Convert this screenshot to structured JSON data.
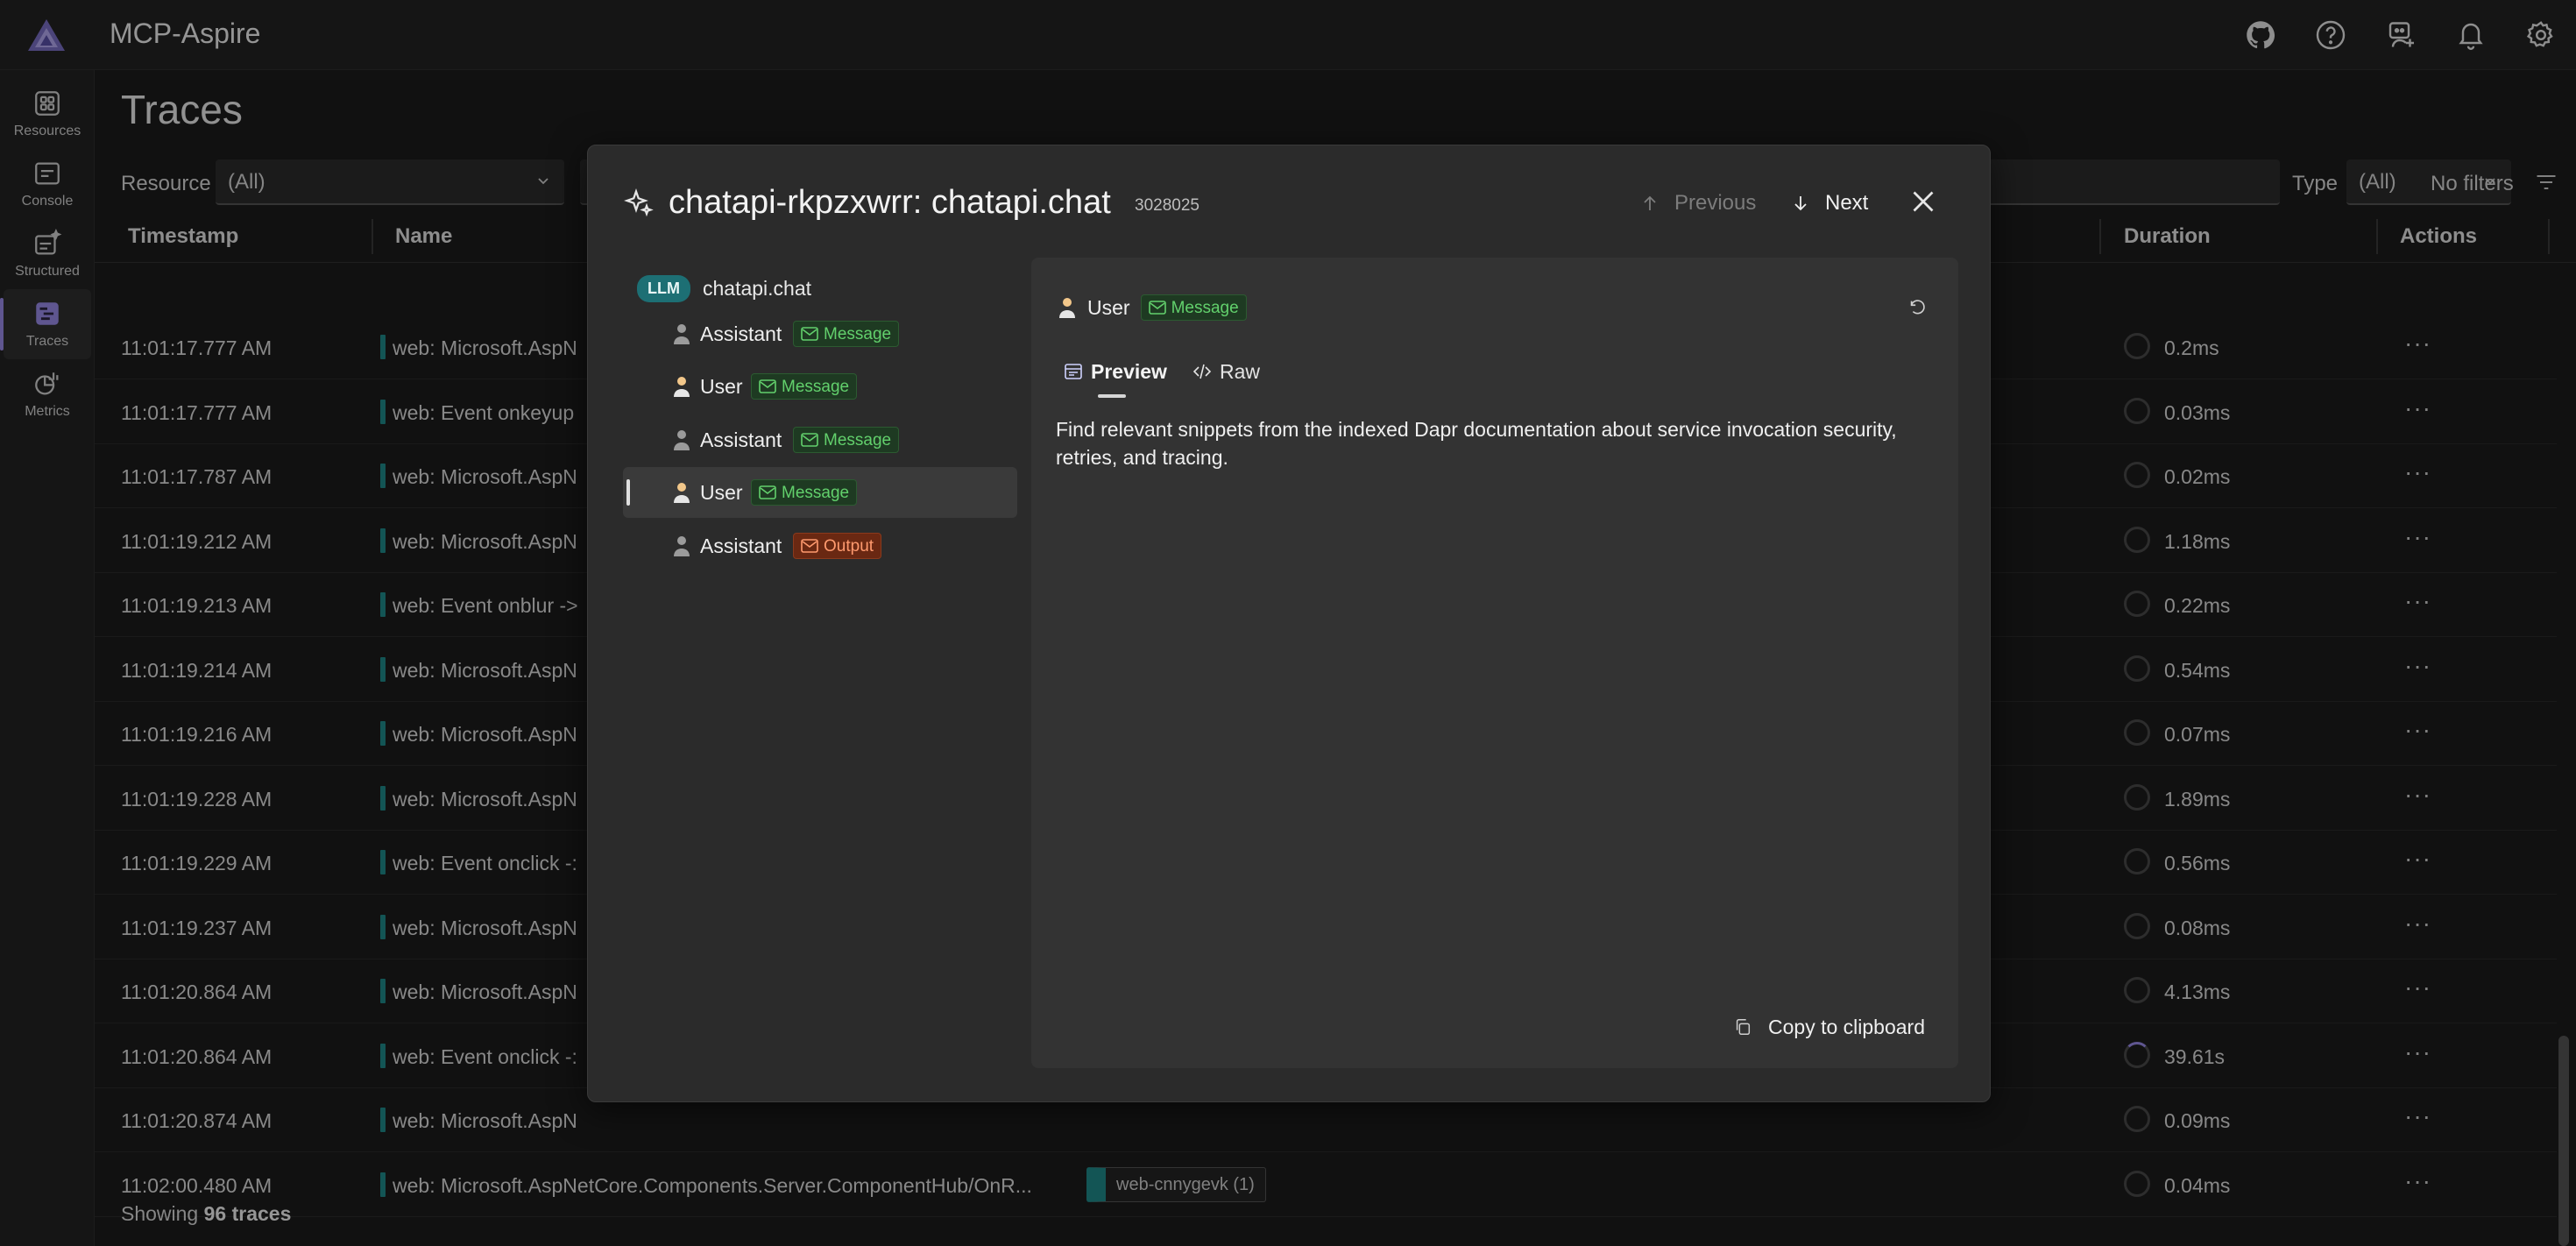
{
  "app": {
    "title": "MCP-Aspire"
  },
  "header_icons": [
    "github-icon",
    "help-icon",
    "dev-assistant-icon",
    "notifications-icon",
    "settings-icon"
  ],
  "nav": {
    "items": [
      {
        "label": "Resources",
        "icon": "resources-icon"
      },
      {
        "label": "Console",
        "icon": "console-icon"
      },
      {
        "label": "Structured",
        "icon": "structured-icon"
      },
      {
        "label": "Traces",
        "icon": "traces-icon",
        "active": true
      },
      {
        "label": "Metrics",
        "icon": "metrics-icon"
      }
    ]
  },
  "page": {
    "title": "Traces",
    "filters": {
      "resource_label": "Resource",
      "resource_value": "(All)",
      "type_label": "Type",
      "type_value": "(All)",
      "no_filters": "No filters"
    },
    "columns": {
      "timestamp": "Timestamp",
      "name": "Name",
      "duration": "Duration",
      "actions": "Actions"
    },
    "rows": [
      {
        "ts": "11:01:17.777 AM",
        "name": "web: Microsoft.AspN",
        "dur": "0.2ms"
      },
      {
        "ts": "11:01:17.777 AM",
        "name": "web: Event onkeyup",
        "dur": "0.03ms"
      },
      {
        "ts": "11:01:17.787 AM",
        "name": "web: Microsoft.AspN",
        "dur": "0.02ms"
      },
      {
        "ts": "11:01:19.212 AM",
        "name": "web: Microsoft.AspN",
        "dur": "1.18ms"
      },
      {
        "ts": "11:01:19.213 AM",
        "name": "web: Event onblur ->",
        "dur": "0.22ms"
      },
      {
        "ts": "11:01:19.214 AM",
        "name": "web: Microsoft.AspN",
        "dur": "0.54ms"
      },
      {
        "ts": "11:01:19.216 AM",
        "name": "web: Microsoft.AspN",
        "dur": "0.07ms"
      },
      {
        "ts": "11:01:19.228 AM",
        "name": "web: Microsoft.AspN",
        "dur": "1.89ms"
      },
      {
        "ts": "11:01:19.229 AM",
        "name": "web: Event onclick -:",
        "dur": "0.56ms"
      },
      {
        "ts": "11:01:19.237 AM",
        "name": "web: Microsoft.AspN",
        "dur": "0.08ms"
      },
      {
        "ts": "11:01:20.864 AM",
        "name": "web: Microsoft.AspN",
        "dur": "4.13ms"
      },
      {
        "ts": "11:01:20.864 AM",
        "name": "web: Event onclick -:",
        "dur": "39.61s"
      },
      {
        "ts": "11:01:20.874 AM",
        "name": "web: Microsoft.AspN",
        "dur": "0.09ms"
      },
      {
        "ts": "11:02:00.480 AM",
        "name": "web: Microsoft.AspNetCore.Components.Server.ComponentHub/OnR...",
        "dur": "0.04ms",
        "resource": "web-cnnygevk (1)"
      }
    ],
    "actions_glyph": "···",
    "footer": {
      "prefix": "Showing",
      "count": "96 traces"
    }
  },
  "dialog": {
    "title": "chatapi-rkpzxwrr: chatapi.chat",
    "id": "3028025",
    "previous": "Previous",
    "next": "Next",
    "tree": {
      "root_badge": "LLM",
      "root_label": "chatapi.chat",
      "items": [
        {
          "label": "Assistant",
          "tag": "Message",
          "kind": "msg"
        },
        {
          "label": "User",
          "tag": "Message",
          "kind": "msg"
        },
        {
          "label": "Assistant",
          "tag": "Message",
          "kind": "msg"
        },
        {
          "label": "User",
          "tag": "Message",
          "kind": "msg",
          "selected": true
        },
        {
          "label": "Assistant",
          "tag": "Output",
          "kind": "out"
        }
      ]
    },
    "detail": {
      "role": "User",
      "tag": "Message",
      "tab_preview": "Preview",
      "tab_raw": "Raw",
      "text": "Find relevant snippets from the indexed Dapr documentation about service invocation security, retries, and tracing.",
      "copy": "Copy to clipboard"
    }
  }
}
